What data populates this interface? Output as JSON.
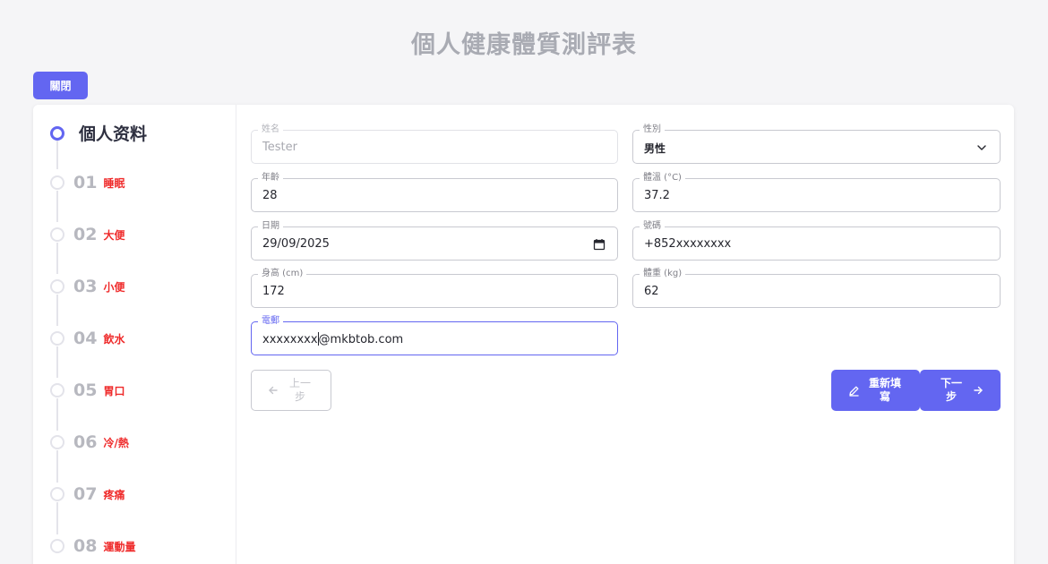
{
  "page": {
    "title": "個人健康體質測評表",
    "close_label": "關閉"
  },
  "steps": [
    {
      "number": "",
      "label": "個人资料",
      "state": "active"
    },
    {
      "number": "01",
      "label": "睡眠"
    },
    {
      "number": "02",
      "label": "大便"
    },
    {
      "number": "03",
      "label": "小便"
    },
    {
      "number": "04",
      "label": "飲水"
    },
    {
      "number": "05",
      "label": "胃口"
    },
    {
      "number": "06",
      "label": "冷/熱"
    },
    {
      "number": "07",
      "label": "疼痛"
    },
    {
      "number": "08",
      "label": "運動量"
    }
  ],
  "form": {
    "name": {
      "label": "姓名",
      "value": "Tester"
    },
    "gender": {
      "label": "性別",
      "value": "男性"
    },
    "age": {
      "label": "年齡",
      "value": "28"
    },
    "temperature": {
      "label": "體溫 (°C)",
      "value": "37.2"
    },
    "date": {
      "label": "日期",
      "value": "29/09/2025"
    },
    "phone": {
      "label": "號碼",
      "value": "+852xxxxxxxx"
    },
    "height": {
      "label": "身高 (cm)",
      "value": "172"
    },
    "weight": {
      "label": "體重 (kg)",
      "value": "62"
    },
    "email": {
      "label": "電郵",
      "value_before_cursor": "xxxxxxxx",
      "value_after_cursor": "@mkbtob.com"
    }
  },
  "buttons": {
    "prev": "上一步",
    "reset": "重新填寫",
    "next": "下一步"
  },
  "colors": {
    "accent": "#6366f1",
    "step_label": "#ef2b2b",
    "background": "#f5f5f7"
  },
  "icons": [
    "arrow-left-icon",
    "pencil-icon",
    "arrow-right-icon",
    "chevron-down-icon",
    "calendar-icon"
  ]
}
